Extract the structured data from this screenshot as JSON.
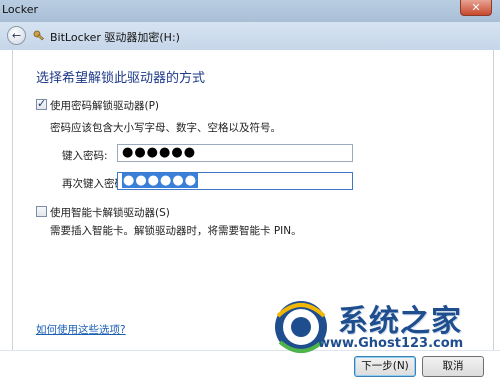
{
  "window": {
    "title": "Locker",
    "close_glyph": "✕"
  },
  "address": {
    "back_glyph": "←",
    "icon": "bitlocker-key-icon",
    "text": "BitLocker 驱动器加密(H:)"
  },
  "main": {
    "heading": "选择希望解锁此驱动器的方式",
    "password_option": {
      "checked": true,
      "label": "使用密码解锁驱动器(P)",
      "hint": "密码应该包含大小写字母、数字、空格以及符号。",
      "enter_label": "键入密码:",
      "enter_value": "●●●●●●",
      "confirm_label": "再次键入密码:",
      "confirm_value": "●●●●●●"
    },
    "smartcard_option": {
      "checked": false,
      "label": "使用智能卡解锁驱动器(S)",
      "hint": "需要插入智能卡。解锁驱动器时，将需要智能卡 PIN。"
    },
    "help_link": "如何使用这些选项?"
  },
  "footer": {
    "next_label": "下一步(N)",
    "cancel_label": "取消"
  },
  "watermark": {
    "name": "系统之家",
    "url": "www.Ghost123.com"
  },
  "colors": {
    "heading": "#1e3a8a",
    "link": "#1a5fb4",
    "selection": "#3b80d8",
    "watermark": "#1f4e8f"
  }
}
